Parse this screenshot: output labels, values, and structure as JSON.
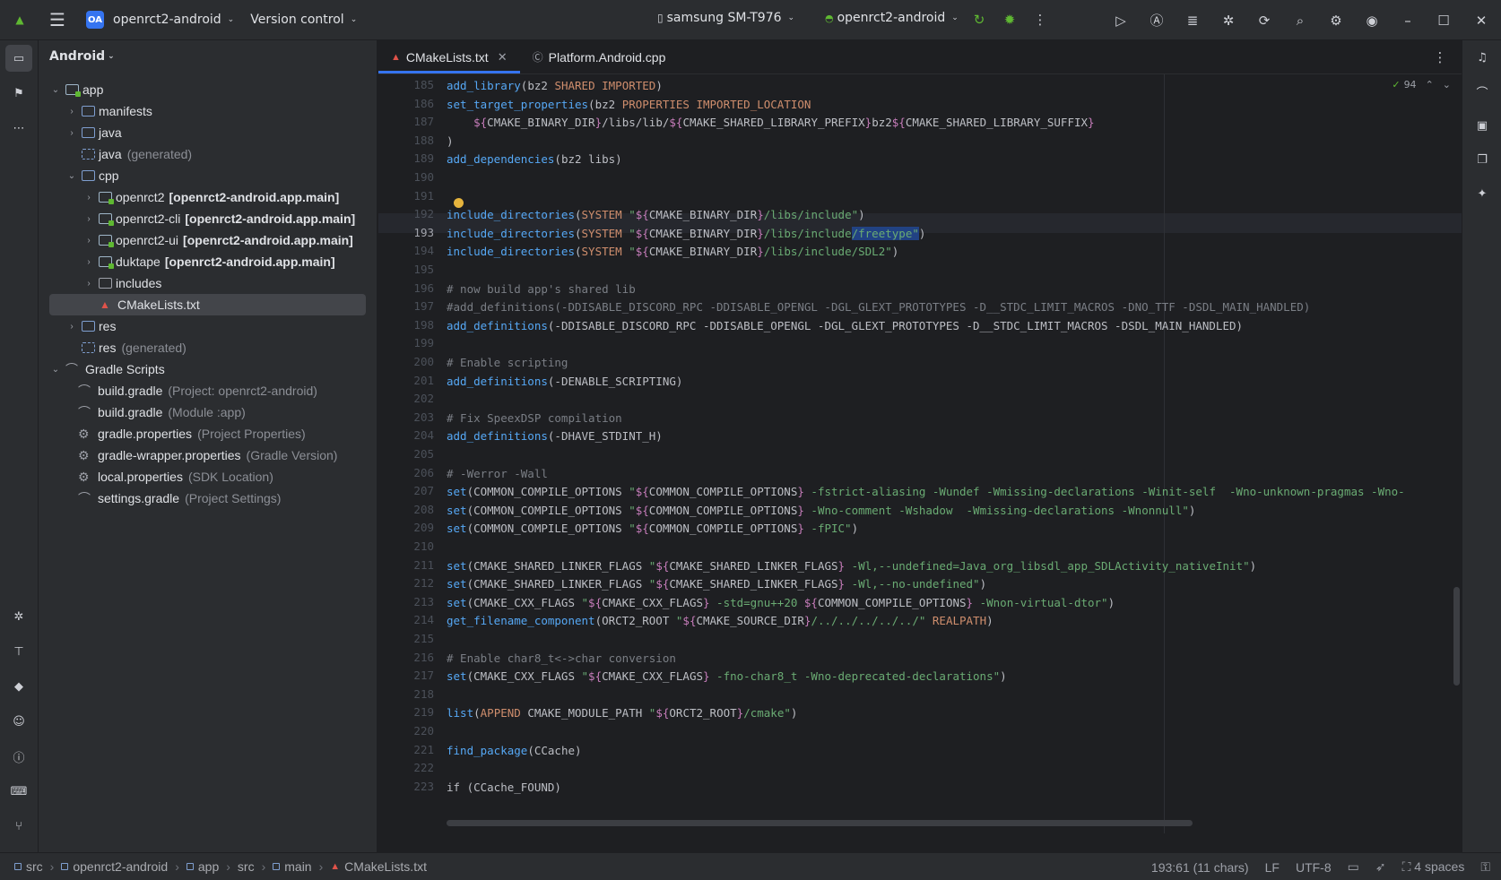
{
  "titlebar": {
    "project_badge": "OA",
    "project_name": "openrct2-android",
    "vcs": "Version control",
    "device": "samsung SM-T976",
    "run_config": "openrct2-android"
  },
  "project_panel": {
    "view_mode": "Android",
    "tree": [
      {
        "label": "app",
        "extra": ""
      },
      {
        "label": "manifests",
        "extra": ""
      },
      {
        "label": "java",
        "extra": ""
      },
      {
        "label": "java",
        "extra": "(generated)"
      },
      {
        "label": "cpp",
        "extra": ""
      },
      {
        "label": "openrct2",
        "extra": "[openrct2-android.app.main]"
      },
      {
        "label": "openrct2-cli",
        "extra": "[openrct2-android.app.main]"
      },
      {
        "label": "openrct2-ui",
        "extra": "[openrct2-android.app.main]"
      },
      {
        "label": "duktape",
        "extra": "[openrct2-android.app.main]"
      },
      {
        "label": "includes",
        "extra": ""
      },
      {
        "label": "CMakeLists.txt",
        "extra": ""
      },
      {
        "label": "res",
        "extra": ""
      },
      {
        "label": "res",
        "extra": "(generated)"
      },
      {
        "label": "Gradle Scripts",
        "extra": ""
      },
      {
        "label": "build.gradle",
        "extra": "(Project: openrct2-android)"
      },
      {
        "label": "build.gradle",
        "extra": "(Module :app)"
      },
      {
        "label": "gradle.properties",
        "extra": "(Project Properties)"
      },
      {
        "label": "gradle-wrapper.properties",
        "extra": "(Gradle Version)"
      },
      {
        "label": "local.properties",
        "extra": "(SDK Location)"
      },
      {
        "label": "settings.gradle",
        "extra": "(Project Settings)"
      }
    ]
  },
  "tabs": [
    {
      "label": "CMakeLists.txt",
      "active": true
    },
    {
      "label": "Platform.Android.cpp",
      "active": false
    }
  ],
  "editor": {
    "inspection_count": "94",
    "current_line": 193,
    "line_numbers": [
      "185",
      "186",
      "187",
      "188",
      "189",
      "190",
      "191",
      "192",
      "193",
      "194",
      "195",
      "196",
      "197",
      "198",
      "199",
      "200",
      "201",
      "202",
      "203",
      "204",
      "205",
      "206",
      "207",
      "208",
      "209",
      "210",
      "211",
      "212",
      "213",
      "214",
      "215",
      "216",
      "217",
      "218",
      "219",
      "220",
      "221",
      "222",
      "223"
    ],
    "lines": [
      "add_library(bz2 SHARED IMPORTED)",
      "set_target_properties(bz2 PROPERTIES IMPORTED_LOCATION",
      "    ${CMAKE_BINARY_DIR}/libs/lib/${CMAKE_SHARED_LIBRARY_PREFIX}bz2${CMAKE_SHARED_LIBRARY_SUFFIX}",
      ")",
      "add_dependencies(bz2 libs)",
      "",
      "",
      "include_directories(SYSTEM \"${CMAKE_BINARY_DIR}/libs/include\")",
      "include_directories(SYSTEM \"${CMAKE_BINARY_DIR}/libs/include/freetype\")",
      "include_directories(SYSTEM \"${CMAKE_BINARY_DIR}/libs/include/SDL2\")",
      "",
      "# now build app's shared lib",
      "#add_definitions(-DDISABLE_DISCORD_RPC -DDISABLE_OPENGL -DGL_GLEXT_PROTOTYPES -D__STDC_LIMIT_MACROS -DNO_TTF -DSDL_MAIN_HANDLED)",
      "add_definitions(-DDISABLE_DISCORD_RPC -DDISABLE_OPENGL -DGL_GLEXT_PROTOTYPES -D__STDC_LIMIT_MACROS -DSDL_MAIN_HANDLED)",
      "",
      "# Enable scripting",
      "add_definitions(-DENABLE_SCRIPTING)",
      "",
      "# Fix SpeexDSP compilation",
      "add_definitions(-DHAVE_STDINT_H)",
      "",
      "# -Werror -Wall",
      "set(COMMON_COMPILE_OPTIONS \"${COMMON_COMPILE_OPTIONS} -fstrict-aliasing -Wundef -Wmissing-declarations -Winit-self  -Wno-unknown-pragmas -Wno-",
      "set(COMMON_COMPILE_OPTIONS \"${COMMON_COMPILE_OPTIONS} -Wno-comment -Wshadow  -Wmissing-declarations -Wnonnull\")",
      "set(COMMON_COMPILE_OPTIONS \"${COMMON_COMPILE_OPTIONS} -fPIC\")",
      "",
      "set(CMAKE_SHARED_LINKER_FLAGS \"${CMAKE_SHARED_LINKER_FLAGS} -Wl,--undefined=Java_org_libsdl_app_SDLActivity_nativeInit\")",
      "set(CMAKE_SHARED_LINKER_FLAGS \"${CMAKE_SHARED_LINKER_FLAGS} -Wl,--no-undefined\")",
      "set(CMAKE_CXX_FLAGS \"${CMAKE_CXX_FLAGS} -std=gnu++20 ${COMMON_COMPILE_OPTIONS} -Wnon-virtual-dtor\")",
      "get_filename_component(ORCT2_ROOT \"${CMAKE_SOURCE_DIR}/../../../../../\" REALPATH)",
      "",
      "# Enable char8_t<->char conversion",
      "set(CMAKE_CXX_FLAGS \"${CMAKE_CXX_FLAGS} -fno-char8_t -Wno-deprecated-declarations\")",
      "",
      "list(APPEND CMAKE_MODULE_PATH \"${ORCT2_ROOT}/cmake\")",
      "",
      "find_package(CCache)",
      "",
      "if (CCache_FOUND)"
    ]
  },
  "statusbar": {
    "breadcrumbs": [
      "src",
      "openrct2-android",
      "app",
      "src",
      "main",
      "CMakeLists.txt"
    ],
    "position": "193:61 (11 chars)",
    "line_sep": "LF",
    "encoding": "UTF-8",
    "indent": "4 spaces"
  },
  "colors": {
    "accent": "#3574f0",
    "background": "#1e1f22",
    "panel": "#2b2d30"
  }
}
